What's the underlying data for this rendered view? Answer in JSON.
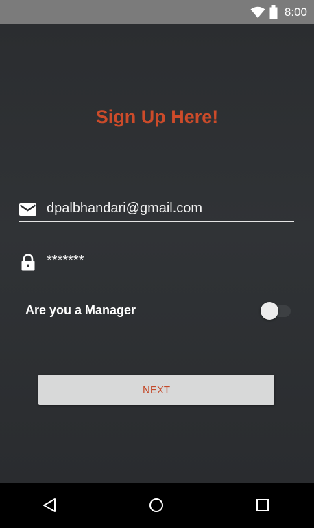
{
  "status_bar": {
    "time": "8:00",
    "icons": [
      "wifi-icon",
      "battery-icon"
    ]
  },
  "signup": {
    "title": "Sign Up Here!",
    "email": {
      "value": "dpalbhandari@gmail.com",
      "icon": "email-icon"
    },
    "password": {
      "value": "*******",
      "icon": "lock-icon"
    },
    "manager_label": "Are you a Manager",
    "manager_toggle_on": false,
    "next_label": "NEXT"
  },
  "nav_bar": {
    "icons": [
      "back-icon",
      "home-icon",
      "recents-icon"
    ]
  },
  "colors": {
    "accent": "#cc4b2a",
    "background": "#2b2d30",
    "status_bar": "#7b7b7b",
    "button": "#d8d9d9"
  }
}
